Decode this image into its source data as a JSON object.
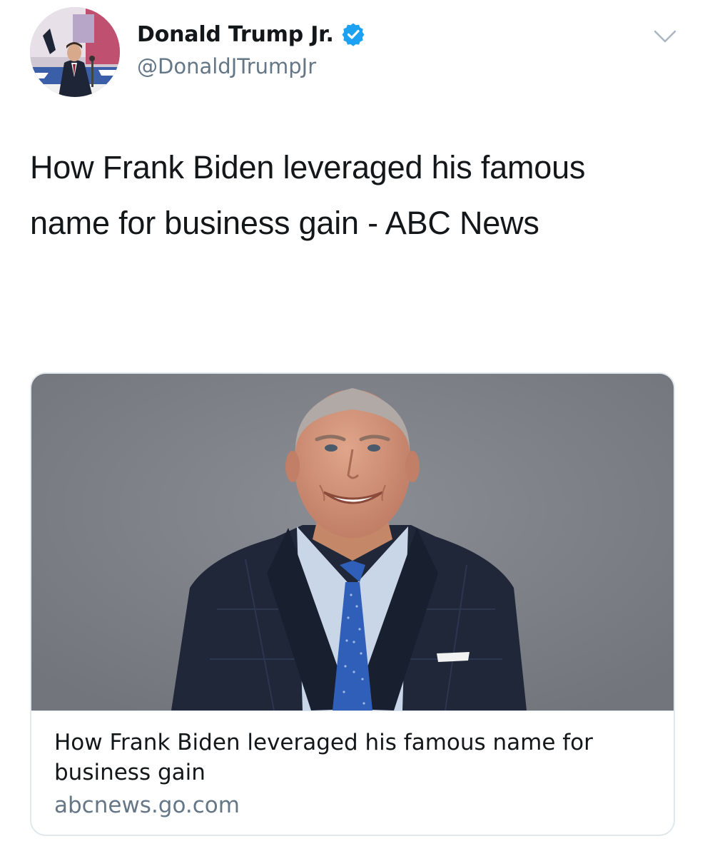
{
  "author": {
    "display_name": "Donald Trump Jr.",
    "handle": "@DonaldJTrumpJr",
    "verified": true,
    "avatar_icon": "profile-photo",
    "verified_icon": "verified-badge-icon",
    "menu_icon": "chevron-down-icon"
  },
  "tweet": {
    "text": "How Frank Biden leveraged his famous name for business gain - ABC News"
  },
  "card": {
    "image_icon": "article-photo",
    "title": "How Frank Biden leveraged his famous name for business gain",
    "domain": "abcnews.go.com"
  },
  "colors": {
    "text_primary": "#14171a",
    "text_secondary": "#657786",
    "verified_blue": "#1da1f2",
    "border": "#e1e8ed"
  }
}
